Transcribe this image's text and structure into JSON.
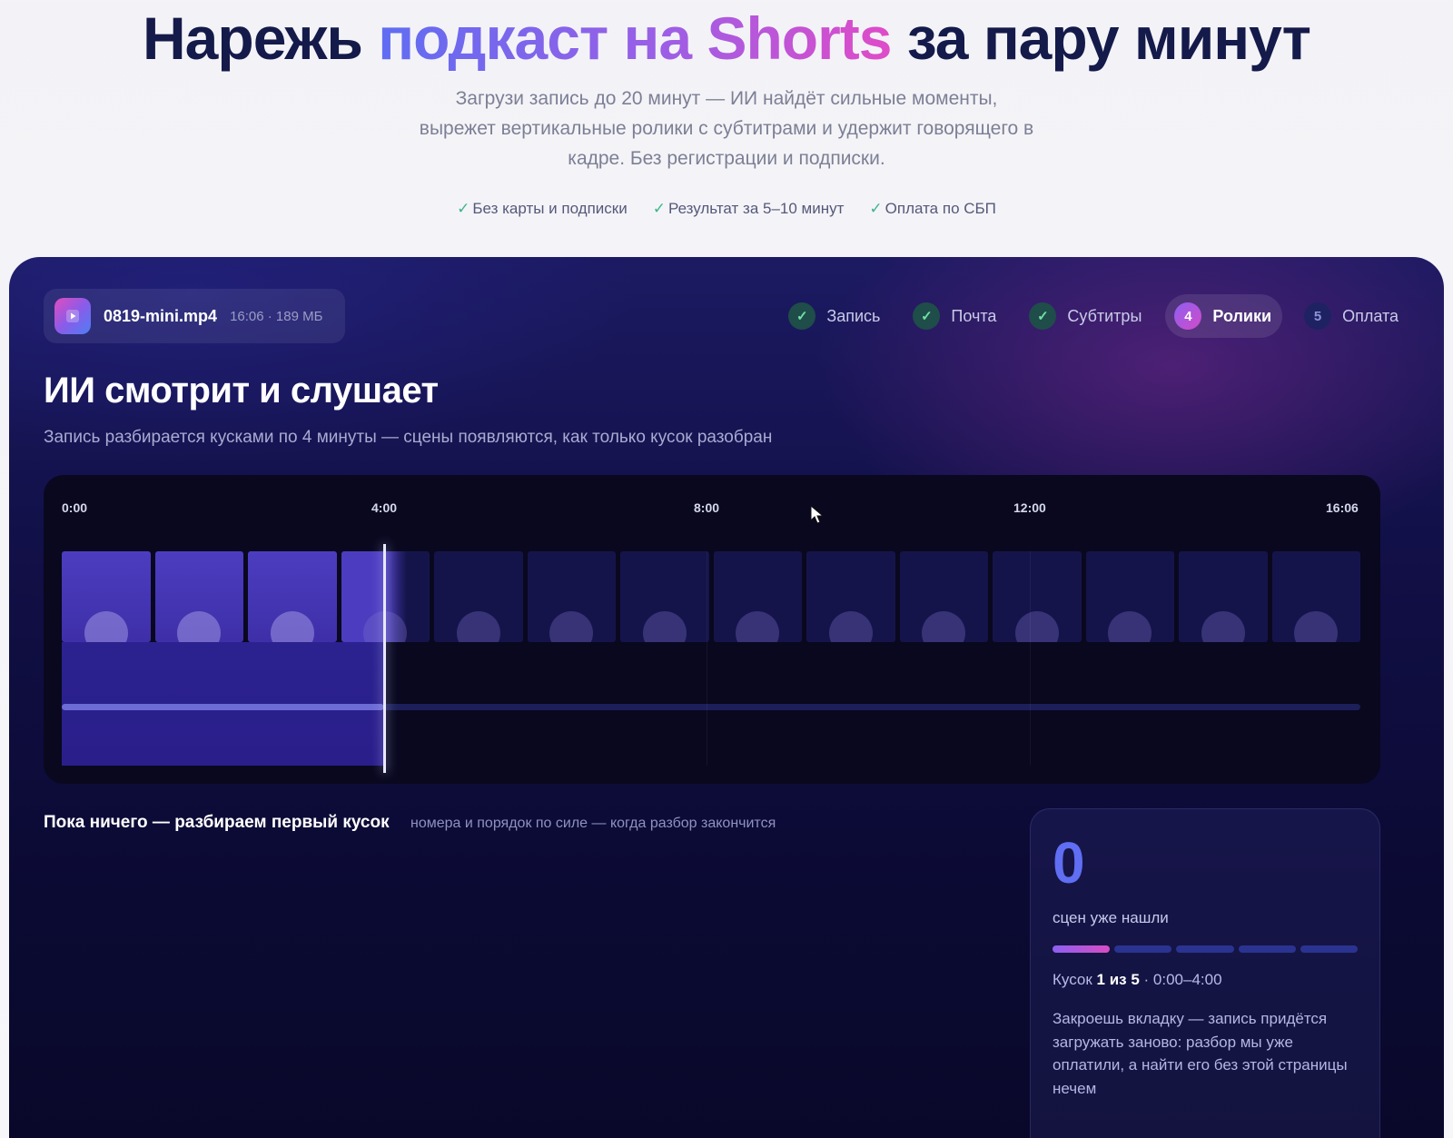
{
  "hero": {
    "title_prefix": "Нарежь ",
    "title_highlight": "подкаст на Shorts",
    "title_suffix": " за пару минут",
    "subtitle": "Загрузи запись до 20 минут — ИИ найдёт сильные моменты, вырежет вертикальные ролики с субтитрами и удержит говорящего в кадре. Без регистрации и подписки.",
    "perks": [
      "Без карты и подписки",
      "Результат за 5–10 минут",
      "Оплата по СБП"
    ]
  },
  "file": {
    "name": "0819-mini.mp4",
    "meta": "16:06 · 189 МБ",
    "icon": "play-icon"
  },
  "steps": [
    {
      "marker": "✓",
      "label": "Запись",
      "state": "done"
    },
    {
      "marker": "✓",
      "label": "Почта",
      "state": "done"
    },
    {
      "marker": "✓",
      "label": "Субтитры",
      "state": "done"
    },
    {
      "marker": "4",
      "label": "Ролики",
      "state": "active"
    },
    {
      "marker": "5",
      "label": "Оплата",
      "state": "todo"
    }
  ],
  "analysis": {
    "title": "ИИ смотрит и слушает",
    "subtitle": "Запись разбирается кусками по 4 минуты — сцены появляются, как только кусок разобран"
  },
  "timeline": {
    "ticks": [
      "0:00",
      "4:00",
      "8:00",
      "12:00",
      "16:06"
    ],
    "duration_seconds": 966,
    "playhead_seconds": 240,
    "frames_count": 14
  },
  "scenes": {
    "empty_message": "Пока ничего — разбираем первый кусок",
    "hint": "номера и порядок по силе — когда разбор закончится"
  },
  "stats": {
    "count": "0",
    "label": "сцен уже нашли",
    "chunks_total": 5,
    "chunks_done": 1,
    "chunk_prefix": "Кусок ",
    "chunk_bold": "1 из 5",
    "chunk_range": " · 0:00–4:00",
    "warning": "Закроешь вкладку — запись придётся загружать заново: разбор мы уже оплатили, а найти его без этой страницы нечем"
  },
  "colors": {
    "accent": "#5f6ef2",
    "pink": "#d84cc3",
    "check": "#3fb58a"
  }
}
